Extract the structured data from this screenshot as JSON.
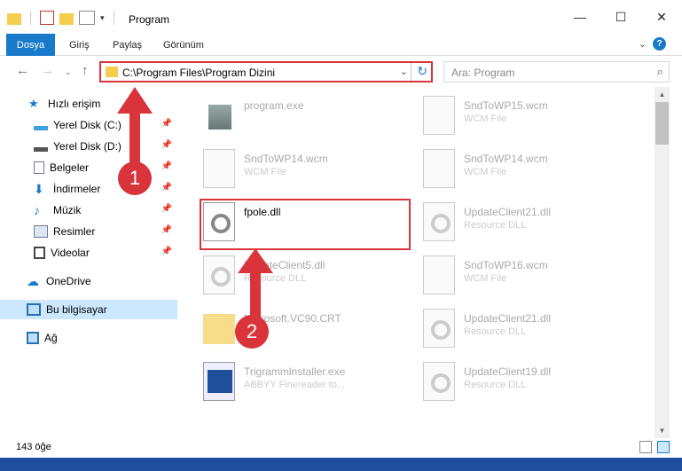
{
  "window": {
    "title": "Program"
  },
  "ribbon": {
    "file_tab": "Dosya",
    "tabs": [
      "Giriş",
      "Paylaş",
      "Görünüm"
    ]
  },
  "address": {
    "path": "C:\\Program Files\\Program Dizini"
  },
  "search": {
    "placeholder": "Ara: Program"
  },
  "sidebar": {
    "quick_access": "Hızlı erişim",
    "items": [
      "Yerel Disk (C:)",
      "Yerel Disk (D:)",
      "Belgeler",
      "İndirmeler",
      "Müzik",
      "Resimler",
      "Videolar"
    ],
    "onedrive": "OneDrive",
    "this_pc": "Bu bilgisayar",
    "network": "Ağ"
  },
  "files": [
    {
      "name": "program.exe",
      "type": ""
    },
    {
      "name": "SndToWP15.wcm",
      "type": "WCM File"
    },
    {
      "name": "SndToWP14.wcm",
      "type": "WCM File"
    },
    {
      "name": "SndToWP14.wcm",
      "type": "WCM File"
    },
    {
      "name": "fpole.dll",
      "type": ""
    },
    {
      "name": "UpdateClient21.dll",
      "type": "Resource DLL"
    },
    {
      "name": "UpdateClient5.dll",
      "type": "Resource DLL"
    },
    {
      "name": "SndToWP16.wcm",
      "type": "WCM File"
    },
    {
      "name": "Microsoft.VC90.CRT",
      "type": ""
    },
    {
      "name": "UpdateClient21.dll",
      "type": "Resource DLL"
    },
    {
      "name": "Trigrammlnstaller.exe",
      "type": "ABBYY Finereader to..."
    },
    {
      "name": "UpdateClient19.dll",
      "type": "Resource DLL"
    }
  ],
  "status": {
    "count": "143 öğe"
  },
  "annotations": {
    "badge1": "1",
    "badge2": "2"
  },
  "colors": {
    "accent": "#1979ca",
    "highlight": "#d9343b"
  }
}
